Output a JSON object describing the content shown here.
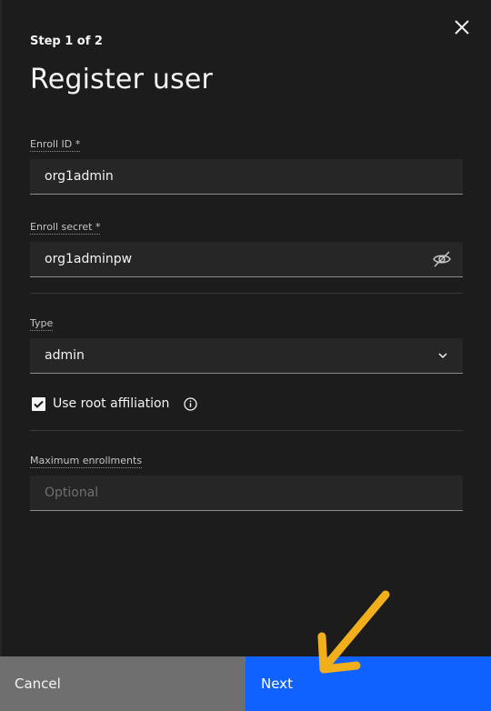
{
  "header": {
    "step": "Step 1 of 2",
    "title": "Register user"
  },
  "form": {
    "enroll_id": {
      "label": "Enroll ID *",
      "value": "org1admin"
    },
    "enroll_secret": {
      "label": "Enroll secret *",
      "value": "org1adminpw"
    },
    "type": {
      "label": "Type",
      "value": "admin"
    },
    "root_affiliation": {
      "label": "Use root affiliation",
      "checked": true
    },
    "max_enrollments": {
      "label": "Maximum enrollments",
      "value": "",
      "placeholder": "Optional"
    }
  },
  "footer": {
    "cancel_label": "Cancel",
    "next_label": "Next"
  },
  "icons": {
    "close": "close-icon",
    "visibility": "eye-off-icon",
    "dropdown": "chevron-down-icon",
    "checkbox": "checkmark-icon",
    "info": "info-icon",
    "annotation": "arrow-annotation"
  },
  "colors": {
    "background": "#1c1c1c",
    "field_background": "#262626",
    "primary_button": "#0f62fe",
    "secondary_button": "#6f6f6f",
    "annotation_arrow": "#f1b01b"
  }
}
